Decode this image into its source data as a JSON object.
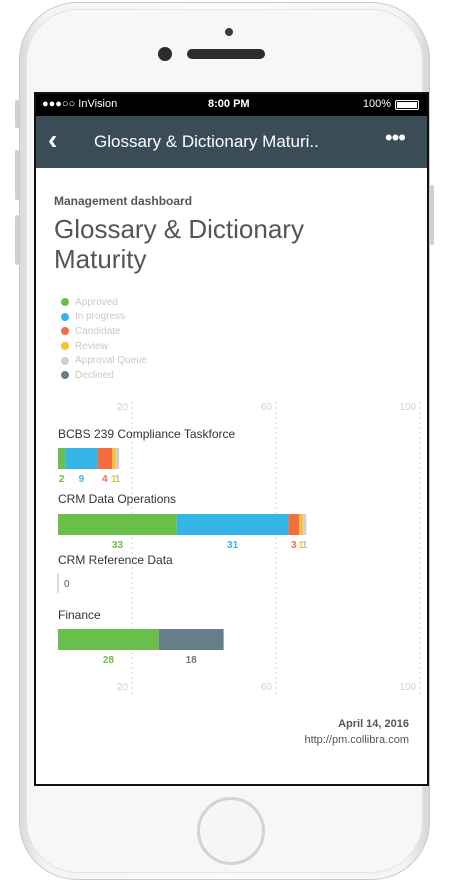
{
  "status_bar": {
    "carrier": "●●●○○ InVision",
    "time": "8:00 PM",
    "battery": "100%"
  },
  "nav": {
    "title": "Glossary & Dictionary Maturi..",
    "back_icon": "chevron-left-icon",
    "more_icon": "ellipsis-icon"
  },
  "header": {
    "subtitle": "Management dashboard",
    "title": "Glossary & Dictionary Maturity"
  },
  "legend": [
    {
      "label": "Approved",
      "color": "#6abf4b"
    },
    {
      "label": "In progress",
      "color": "#35b5e5"
    },
    {
      "label": "Candidate",
      "color": "#f26e3f"
    },
    {
      "label": "Review",
      "color": "#fbbf32"
    },
    {
      "label": "Approval Queue",
      "color": "#d0d0d0"
    },
    {
      "label": "Declined",
      "color": "#667d8a"
    }
  ],
  "chart_data": {
    "type": "bar",
    "orientation": "horizontal",
    "stacked": true,
    "x_ticks": [
      20,
      60,
      100
    ],
    "xlim": [
      0,
      100
    ],
    "grid": true,
    "categories": [
      "BCBS 239 Compliance Taskforce",
      "CRM Data Operations",
      "CRM Reference Data",
      "Finance"
    ],
    "series": [
      {
        "name": "Approved",
        "values": [
          2,
          33,
          0,
          28
        ]
      },
      {
        "name": "In progress",
        "values": [
          9,
          31,
          0,
          0
        ]
      },
      {
        "name": "Candidate",
        "values": [
          4,
          3,
          0,
          0
        ]
      },
      {
        "name": "Review",
        "values": [
          1,
          1,
          0,
          0
        ]
      },
      {
        "name": "Approval Queue",
        "values": [
          1,
          1,
          0,
          0
        ]
      },
      {
        "name": "Declined",
        "values": [
          0,
          0,
          0,
          18
        ]
      }
    ],
    "zero_labels": [
      false,
      false,
      true,
      false
    ]
  },
  "footer": {
    "date": "April 14, 2016",
    "url": "http://pm.collibra.com"
  }
}
